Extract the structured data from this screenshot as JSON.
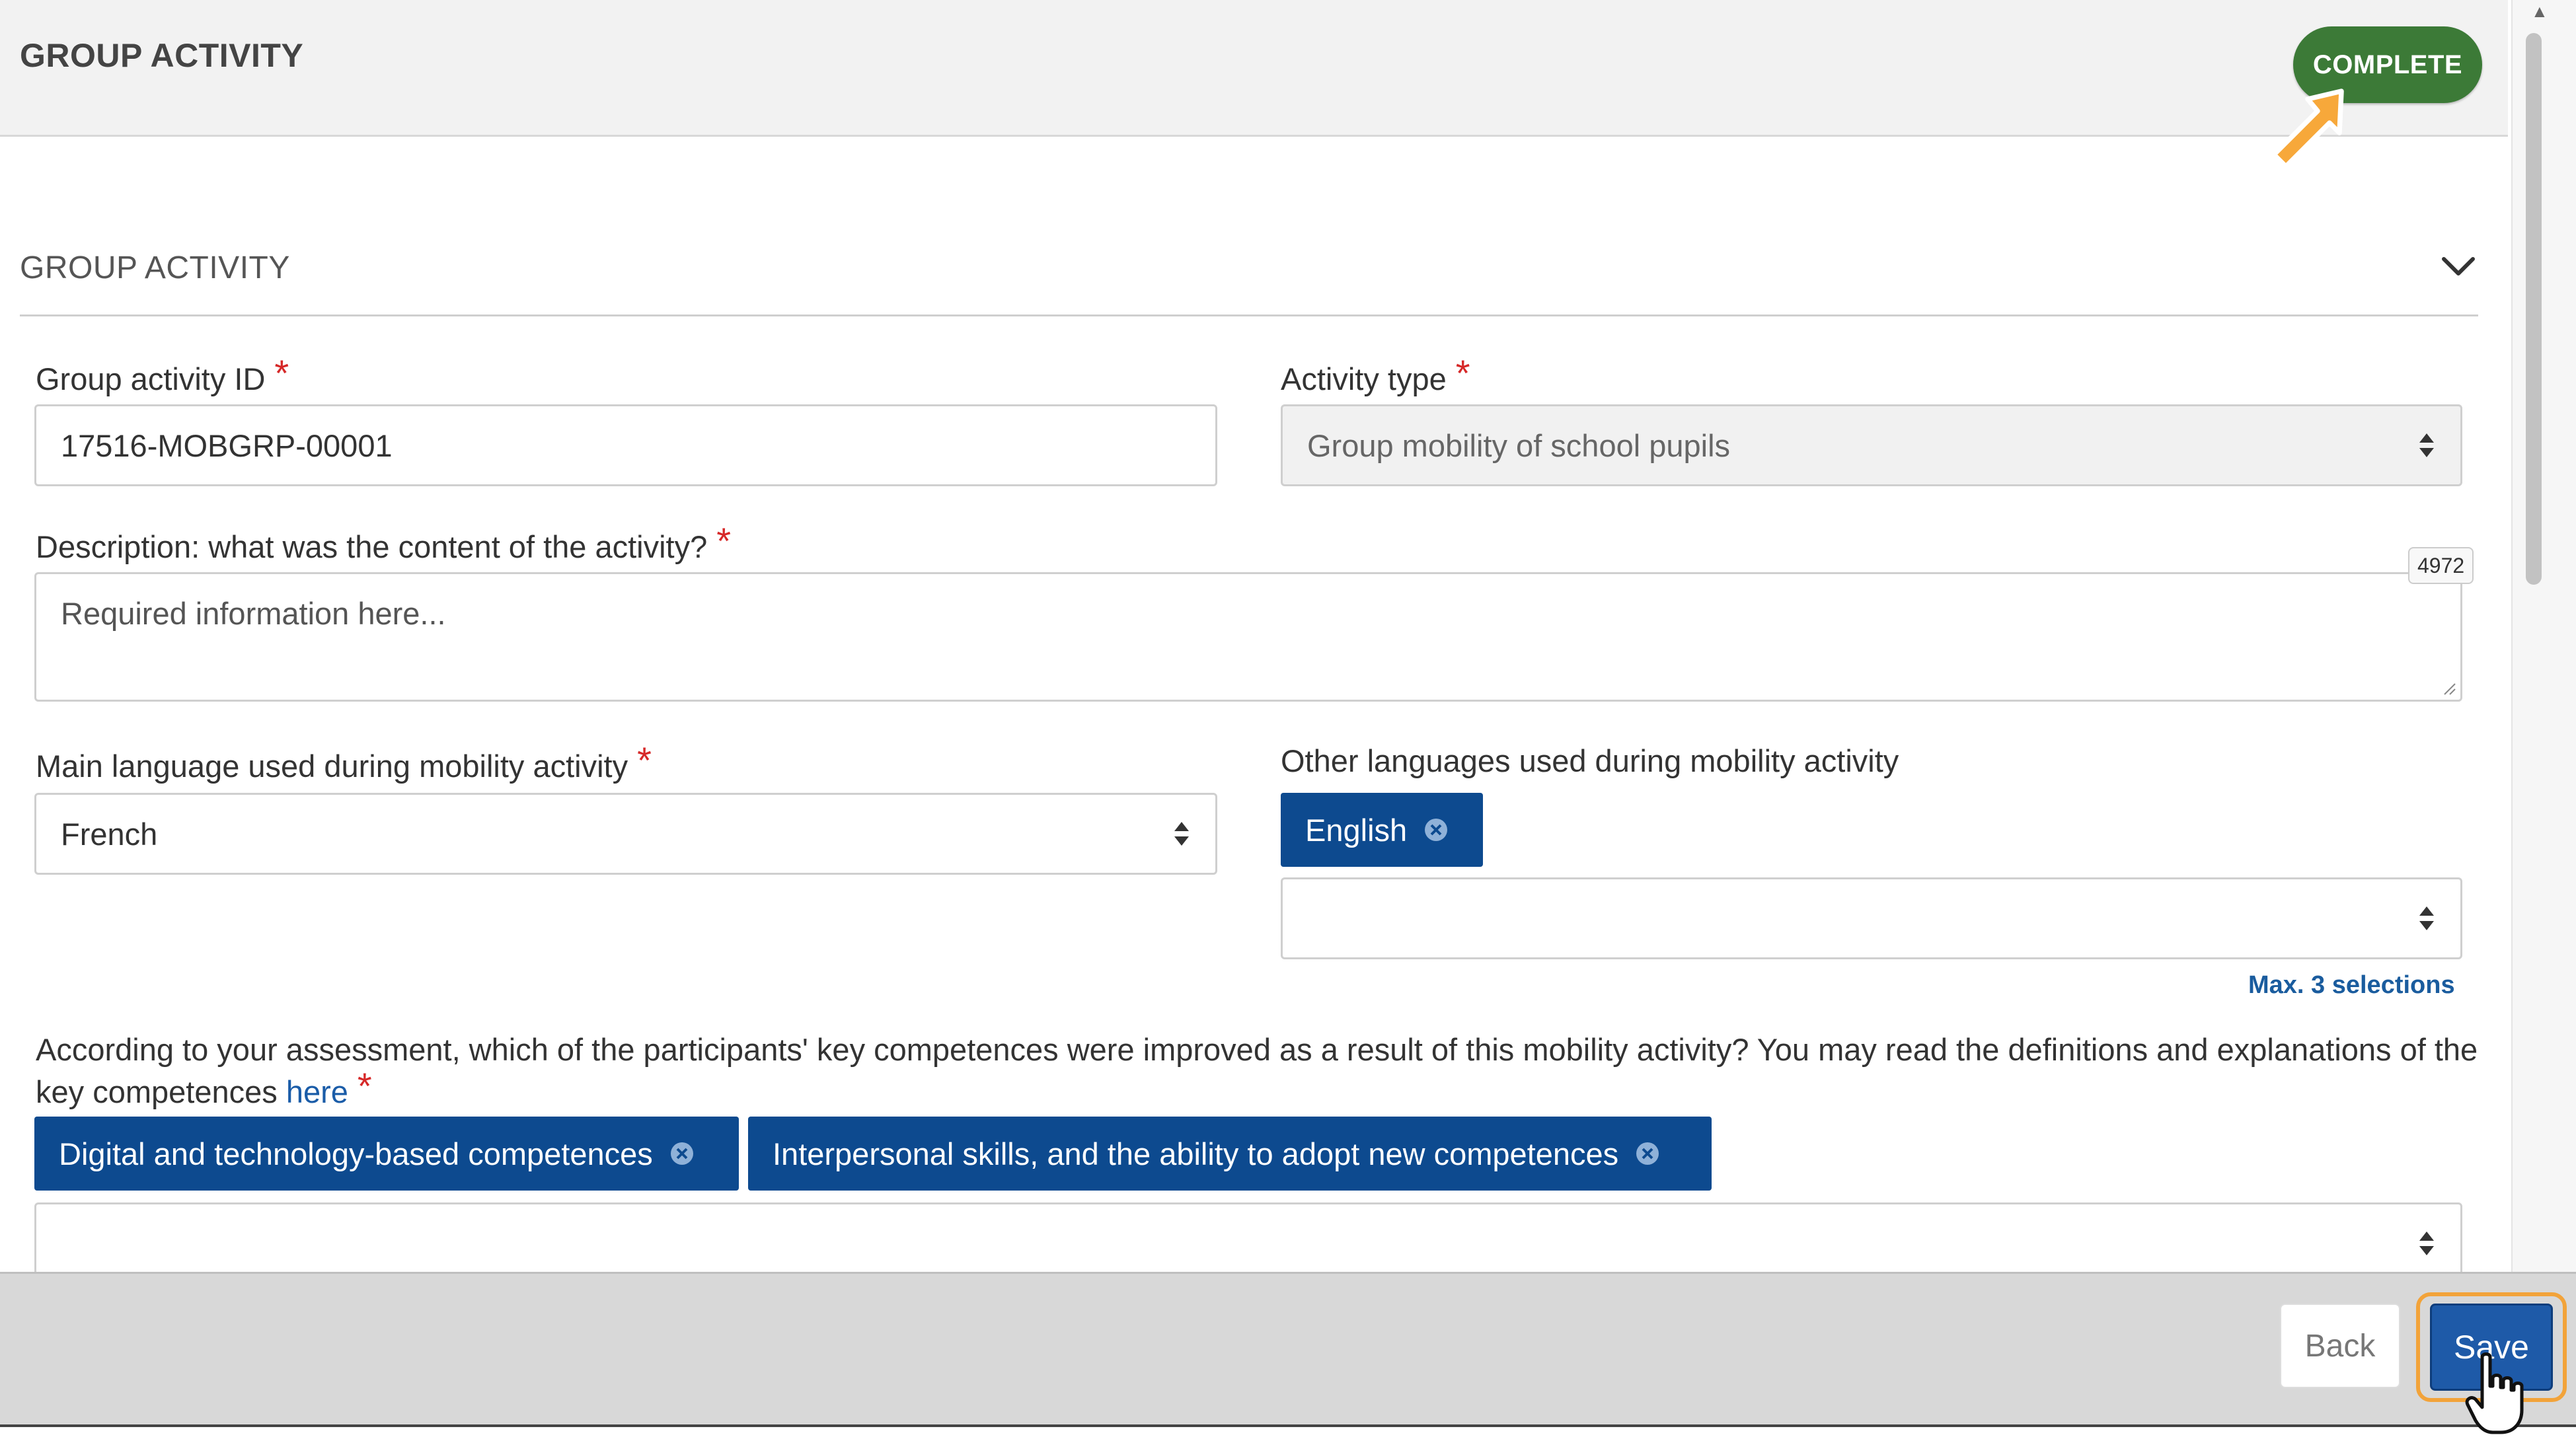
{
  "header": {
    "title": "GROUP ACTIVITY",
    "status_badge": "COMPLETE",
    "badge_color": "#3c7a37"
  },
  "section": {
    "title": "GROUP ACTIVITY",
    "toggle_icon": "chevron-down-icon"
  },
  "form": {
    "group_activity_id": {
      "label": "Group activity ID",
      "value": "17516-MOBGRP-00001"
    },
    "activity_type": {
      "label": "Activity type",
      "value": "Group mobility of school pupils"
    },
    "description": {
      "label": "Description: what was the content of the activity?",
      "placeholder": "Required information here...",
      "counter": "4972"
    },
    "main_language": {
      "label": "Main language used during mobility activity",
      "value": "French"
    },
    "other_languages": {
      "label": "Other languages used during mobility activity",
      "selected": [
        "English"
      ],
      "hint": "Max. 3 selections"
    },
    "key_competences": {
      "label_text": "According to your assessment, which of the participants' key competences were improved as a result of this mobility activity? You may read the definitions and explanations of the key competences",
      "link_text": "here",
      "selected": [
        "Digital and technology-based competences",
        "Interpersonal skills, and the ability to adopt new competences"
      ]
    },
    "required_marker": "*"
  },
  "footer": {
    "back_label": "Back",
    "save_label": "Save"
  },
  "colors": {
    "accent": "#0d4a8f",
    "required": "#d62828",
    "highlight": "#f2a33a"
  }
}
